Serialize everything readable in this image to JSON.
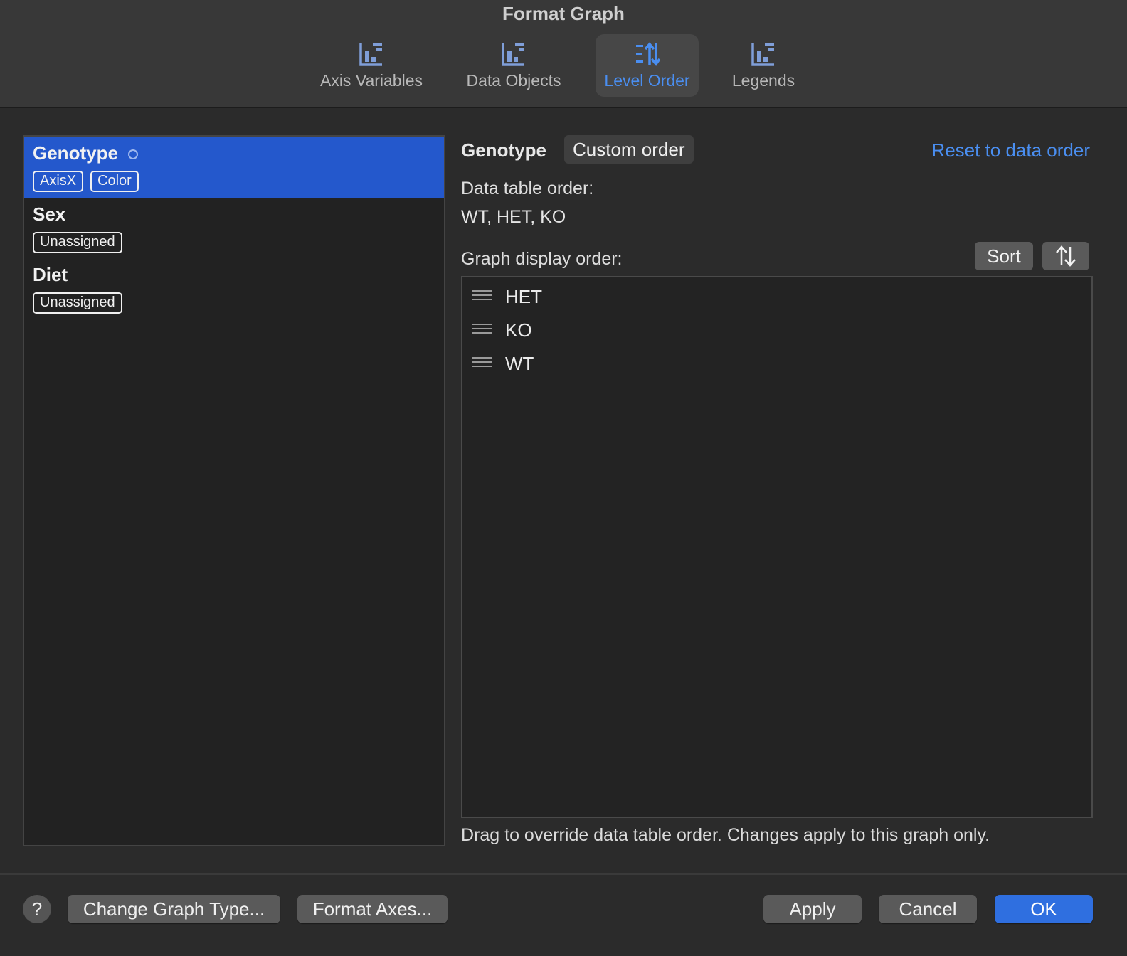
{
  "window": {
    "title": "Format Graph"
  },
  "tabs": [
    {
      "label": "Axis Variables",
      "icon": "bar-chart-icon",
      "active": false
    },
    {
      "label": "Data Objects",
      "icon": "bar-chart-icon",
      "active": false
    },
    {
      "label": "Level Order",
      "icon": "sort-levels-icon",
      "active": true
    },
    {
      "label": "Legends",
      "icon": "bar-chart-icon",
      "active": false
    }
  ],
  "variables": [
    {
      "name": "Genotype",
      "badges": [
        "AxisX",
        "Color"
      ],
      "selected": true,
      "modified_indicator": true
    },
    {
      "name": "Sex",
      "badges": [
        "Unassigned"
      ],
      "selected": false
    },
    {
      "name": "Diet",
      "badges": [
        "Unassigned"
      ],
      "selected": false
    }
  ],
  "detail": {
    "variable_name": "Genotype",
    "order_mode": "Custom order",
    "reset_label": "Reset to data order",
    "data_table_order_label": "Data table order:",
    "data_table_order": "WT, HET, KO",
    "graph_display_order_label": "Graph display order:",
    "sort_label": "Sort",
    "reverse_icon": "↑↓",
    "display_order": [
      "HET",
      "KO",
      "WT"
    ],
    "hint": "Drag to override data table order. Changes apply to this graph only."
  },
  "footer": {
    "help_label": "?",
    "change_graph_type_label": "Change Graph Type...",
    "format_axes_label": "Format Axes...",
    "apply_label": "Apply",
    "cancel_label": "Cancel",
    "ok_label": "OK"
  },
  "colors": {
    "accent": "#4a8ef0",
    "selection": "#2458cc",
    "primary_button": "#2f6fe0",
    "background": "#2b2b2b"
  }
}
